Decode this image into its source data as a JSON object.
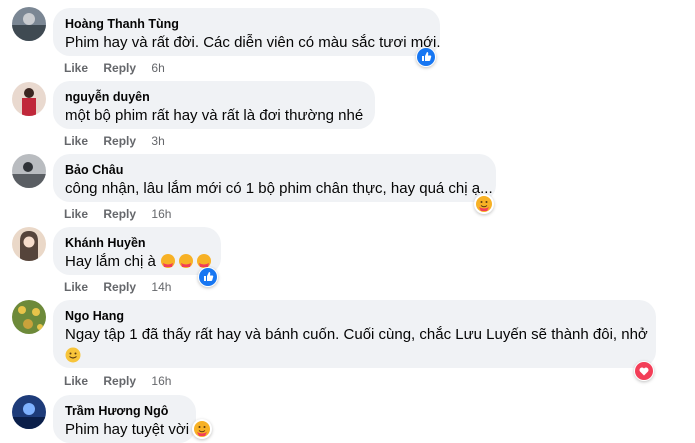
{
  "comments": [
    {
      "name": "Hoàng Thanh Tùng",
      "text": "Phim hay và rất đời. Các diễn viên có màu sắc tươi mới.",
      "like": "Like",
      "reply": "Reply",
      "time": "6h"
    },
    {
      "name": "nguyễn duyên",
      "text": "một bộ phim rất hay và rất là đơi thường nhé",
      "like": "Like",
      "reply": "Reply",
      "time": "3h"
    },
    {
      "name": "Bảo Châu",
      "text": "công nhận, lâu lắm mới có 1 bộ phim chân thực, hay quá chị ạ...",
      "like": "Like",
      "reply": "Reply",
      "time": "16h"
    },
    {
      "name": "Khánh Huyền",
      "text": "Hay lắm chị à",
      "like": "Like",
      "reply": "Reply",
      "time": "14h"
    },
    {
      "name": "Ngo Hang",
      "text": "Ngay tập 1 đã thấy rất hay và bánh cuốn. Cuối cùng, chắc Lưu Luyến sẽ thành đôi, nhở",
      "like": "Like",
      "reply": "Reply",
      "time": "16h"
    },
    {
      "name": "Trầm Hương Ngô",
      "text": "Phim hay tuyệt vời"
    }
  ],
  "reactions": {
    "like_icon": "thumbs-up-icon",
    "care_icon": "care-hug-icon",
    "love_icon": "heart-icon",
    "smile_icon": "smiling-face-icon"
  },
  "colors": {
    "bubble": "#f0f2f5",
    "meta": "#65676b",
    "like_blue": "#1877f2",
    "love_red": "#f33e58"
  }
}
